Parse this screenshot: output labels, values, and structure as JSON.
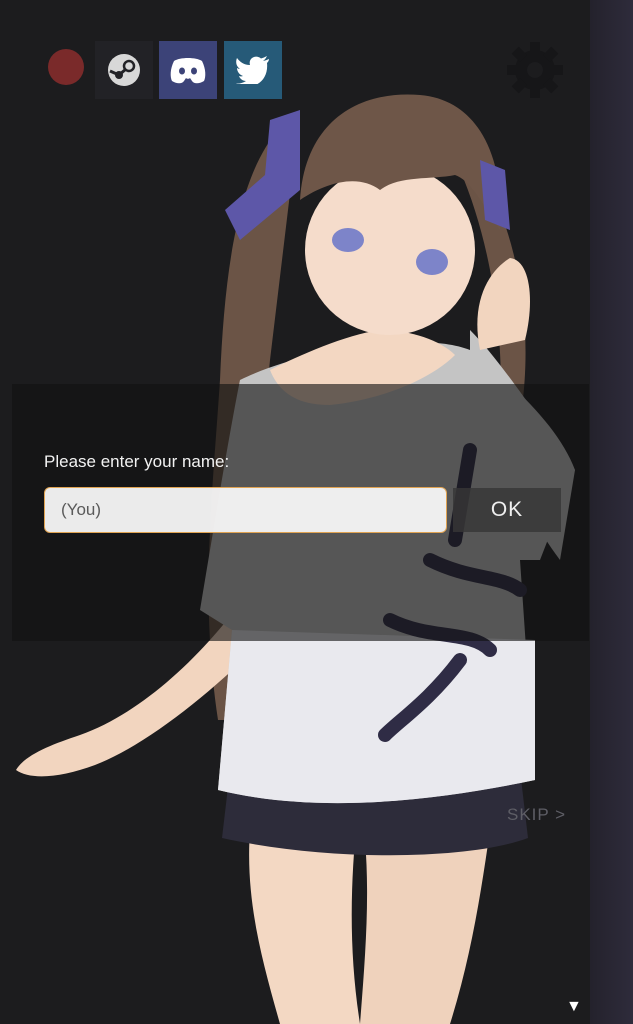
{
  "topbar": {
    "record_icon": "record-dot-icon",
    "steam_icon": "steam-icon",
    "discord_icon": "discord-icon",
    "twitter_icon": "twitter-icon",
    "settings_icon": "gear-icon",
    "colors": {
      "record": "#7a2a2a",
      "steam": "#222226",
      "discord": "#3c4378",
      "twitter": "#265a78"
    }
  },
  "dialog": {
    "prompt": "Please enter your name:",
    "input_placeholder": "(You)",
    "input_value": "",
    "ok_label": "OK",
    "accent": "#e0a352"
  },
  "footer": {
    "skip_label": "SKIP >",
    "advance_label": "▼"
  }
}
